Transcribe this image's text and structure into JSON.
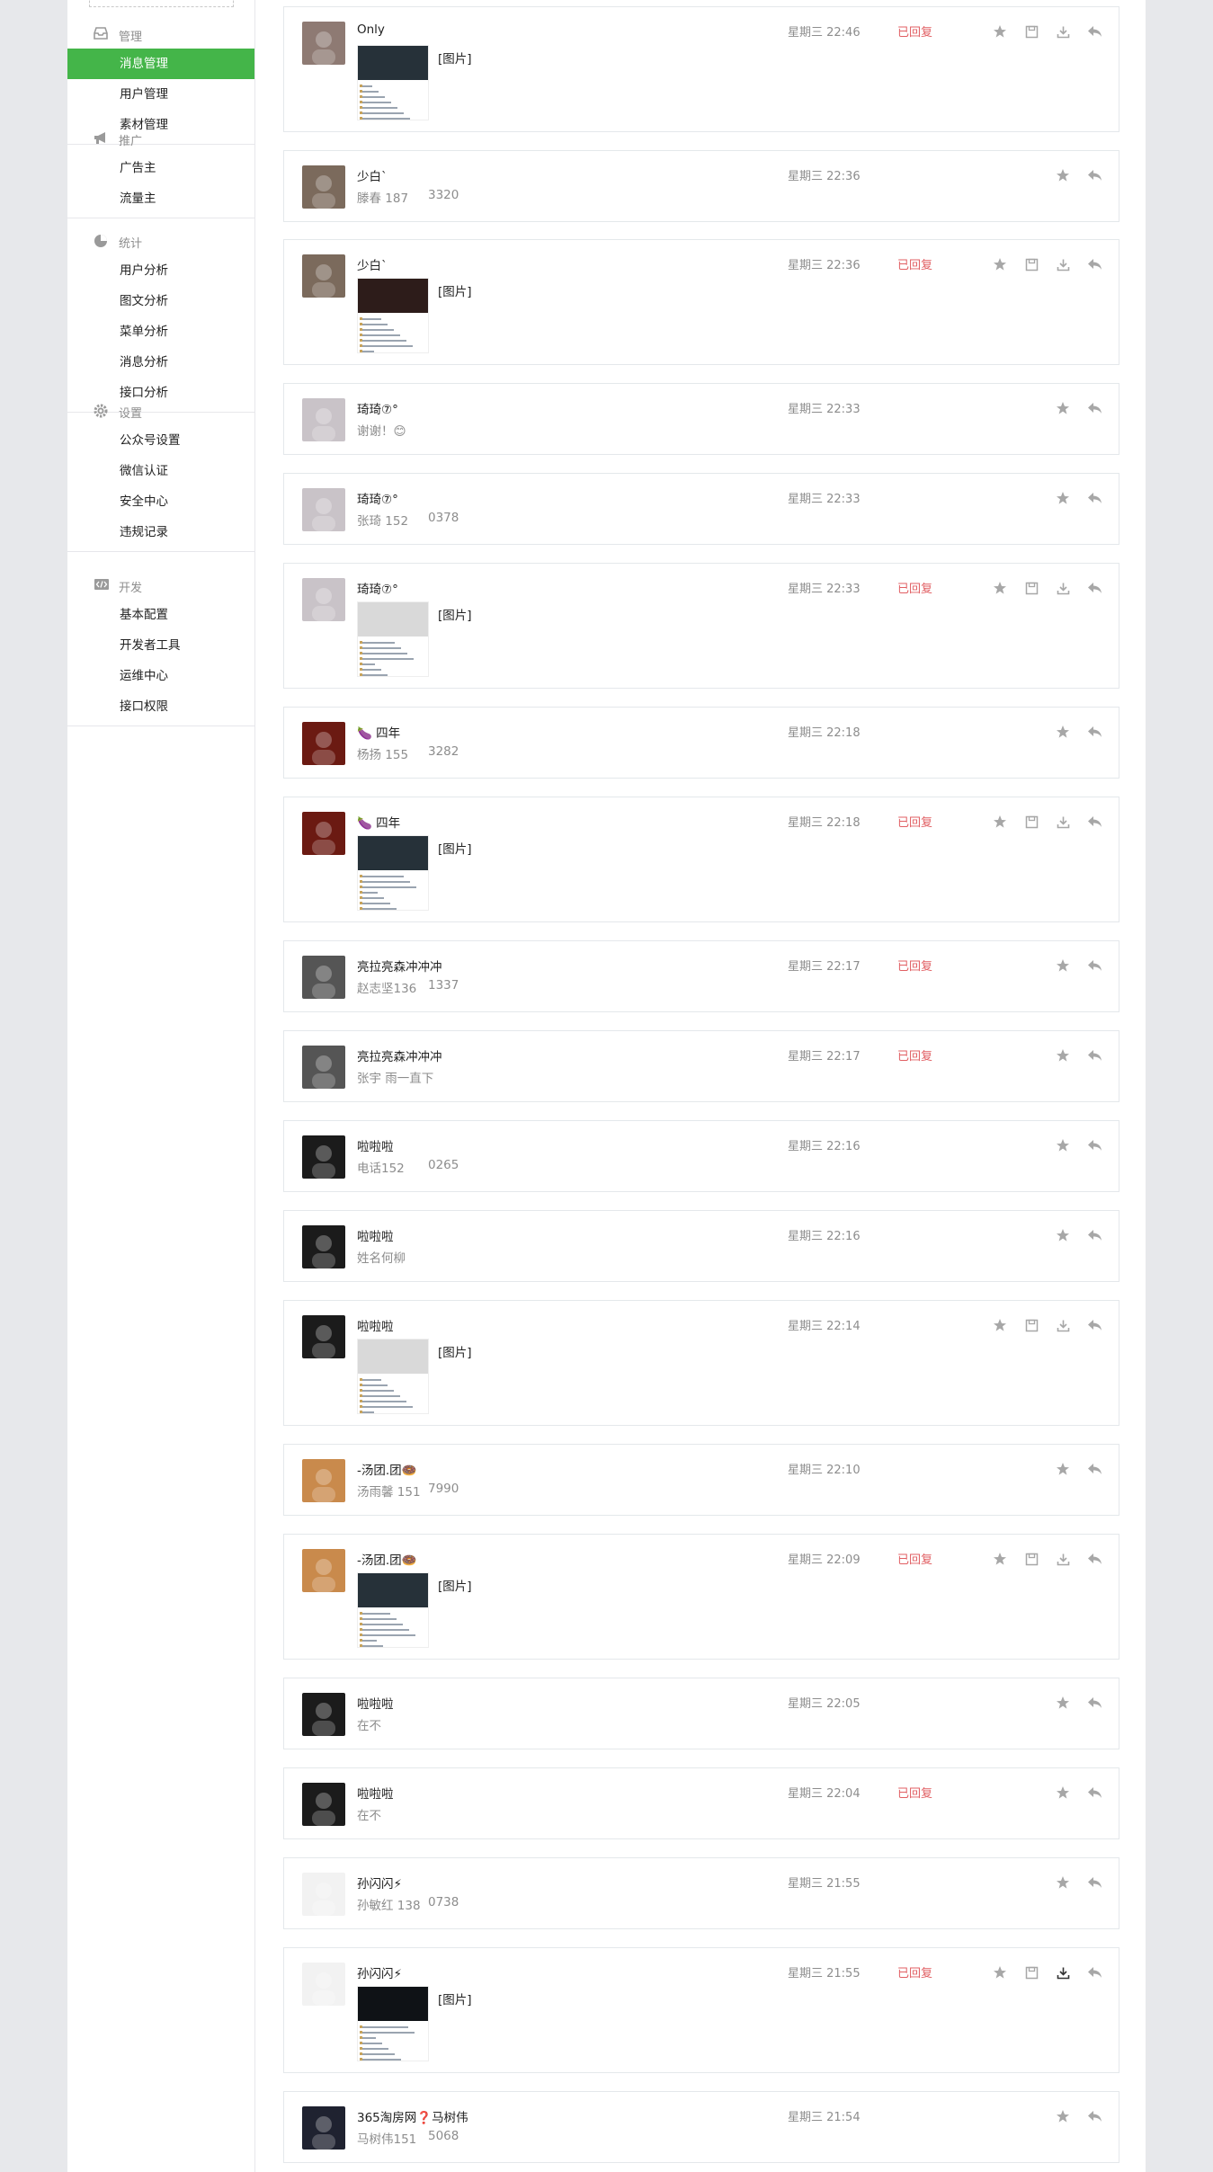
{
  "sidebar": {
    "groups": [
      {
        "title": "管理",
        "icon": "inbox-icon",
        "items": [
          "消息管理",
          "用户管理",
          "素材管理"
        ],
        "active": 0
      },
      {
        "title": "推广",
        "icon": "megaphone-icon",
        "items": [
          "广告主",
          "流量主"
        ]
      },
      {
        "title": "统计",
        "icon": "pie-chart-icon",
        "items": [
          "用户分析",
          "图文分析",
          "菜单分析",
          "消息分析",
          "接口分析"
        ]
      },
      {
        "title": "设置",
        "icon": "gear-icon",
        "items": [
          "公众号设置",
          "微信认证",
          "安全中心",
          "违规记录"
        ]
      },
      {
        "title": "开发",
        "icon": "code-icon",
        "items": [
          "基本配置",
          "开发者工具",
          "运维中心",
          "接口权限"
        ]
      }
    ]
  },
  "colors": {
    "accent": "#44b549",
    "replied": "#e15f63",
    "muted": "#8d8d8d"
  },
  "messages": [
    {
      "nick": "Only",
      "time": "星期三 22:46",
      "replied": "已回复",
      "type": "image",
      "image_label": "[图片]",
      "avatar_color": "#8e7a73"
    },
    {
      "nick": "少白`",
      "time": "星期三 22:36",
      "replied": "",
      "type": "text",
      "text": "滕春 187",
      "text_tail": "3320",
      "avatar_color": "#7b6a5c"
    },
    {
      "nick": "少白`",
      "time": "星期三 22:36",
      "replied": "已回复",
      "type": "image",
      "image_label": "[图片]",
      "avatar_color": "#7b6a5c"
    },
    {
      "nick": "琦琦⑦°",
      "time": "星期三 22:33",
      "replied": "",
      "type": "text",
      "text": "谢谢！😊",
      "text_tail": "",
      "avatar_color": "#c9c3c8"
    },
    {
      "nick": "琦琦⑦°",
      "time": "星期三 22:33",
      "replied": "",
      "type": "text",
      "text": "张琦 152",
      "text_tail": "0378",
      "avatar_color": "#c9c3c8"
    },
    {
      "nick": "琦琦⑦°",
      "time": "星期三 22:33",
      "replied": "已回复",
      "type": "image",
      "image_label": "[图片]",
      "avatar_color": "#c9c3c8"
    },
    {
      "nick": "🍆 四年",
      "time": "星期三 22:18",
      "replied": "",
      "type": "text",
      "text": "杨扬 155",
      "text_tail": "3282",
      "avatar_color": "#6b1a12"
    },
    {
      "nick": "🍆 四年",
      "time": "星期三 22:18",
      "replied": "已回复",
      "type": "image",
      "image_label": "[图片]",
      "avatar_color": "#6b1a12"
    },
    {
      "nick": "亮拉亮森冲冲冲",
      "time": "星期三 22:17",
      "replied": "已回复",
      "type": "text",
      "text": "赵志坚136",
      "text_tail": "1337",
      "avatar_color": "#555"
    },
    {
      "nick": "亮拉亮森冲冲冲",
      "time": "星期三 22:17",
      "replied": "已回复",
      "type": "text",
      "text": "张宇 雨一直下",
      "text_tail": "",
      "avatar_color": "#555"
    },
    {
      "nick": "啦啦啦",
      "time": "星期三 22:16",
      "replied": "",
      "type": "text",
      "text": "电话152",
      "text_tail": "0265",
      "avatar_color": "#1b1b1b"
    },
    {
      "nick": "啦啦啦",
      "time": "星期三 22:16",
      "replied": "",
      "type": "text",
      "text": "姓名何柳",
      "text_tail": "",
      "avatar_color": "#1b1b1b"
    },
    {
      "nick": "啦啦啦",
      "time": "星期三 22:14",
      "replied": "",
      "type": "image",
      "image_label": "[图片]",
      "avatar_color": "#1b1b1b"
    },
    {
      "nick": "-汤团.团🍩",
      "time": "星期三 22:10",
      "replied": "",
      "type": "text",
      "text": "汤雨馨 151",
      "text_tail": "7990",
      "avatar_color": "#c98a4c"
    },
    {
      "nick": "-汤团.团🍩",
      "time": "星期三 22:09",
      "replied": "已回复",
      "type": "image",
      "image_label": "[图片]",
      "avatar_color": "#c98a4c"
    },
    {
      "nick": "啦啦啦",
      "time": "星期三 22:05",
      "replied": "",
      "type": "text",
      "text": "在不",
      "text_tail": "",
      "avatar_color": "#1b1b1b"
    },
    {
      "nick": "啦啦啦",
      "time": "星期三 22:04",
      "replied": "已回复",
      "type": "text",
      "text": "在不",
      "text_tail": "",
      "avatar_color": "#1b1b1b"
    },
    {
      "nick": "孙闪闪⚡",
      "time": "星期三 21:55",
      "replied": "",
      "type": "text",
      "text": "孙敏红 138",
      "text_tail": "0738",
      "avatar_color": "#f2f2f2"
    },
    {
      "nick": "孙闪闪⚡",
      "time": "星期三 21:55",
      "replied": "已回复",
      "type": "image",
      "image_label": "[图片]",
      "avatar_color": "#f2f2f2"
    },
    {
      "nick": "365淘房网❓马树伟",
      "time": "星期三 21:54",
      "replied": "",
      "type": "text",
      "text": "马树伟151",
      "text_tail": "5068",
      "avatar_color": "#1f2230"
    }
  ]
}
